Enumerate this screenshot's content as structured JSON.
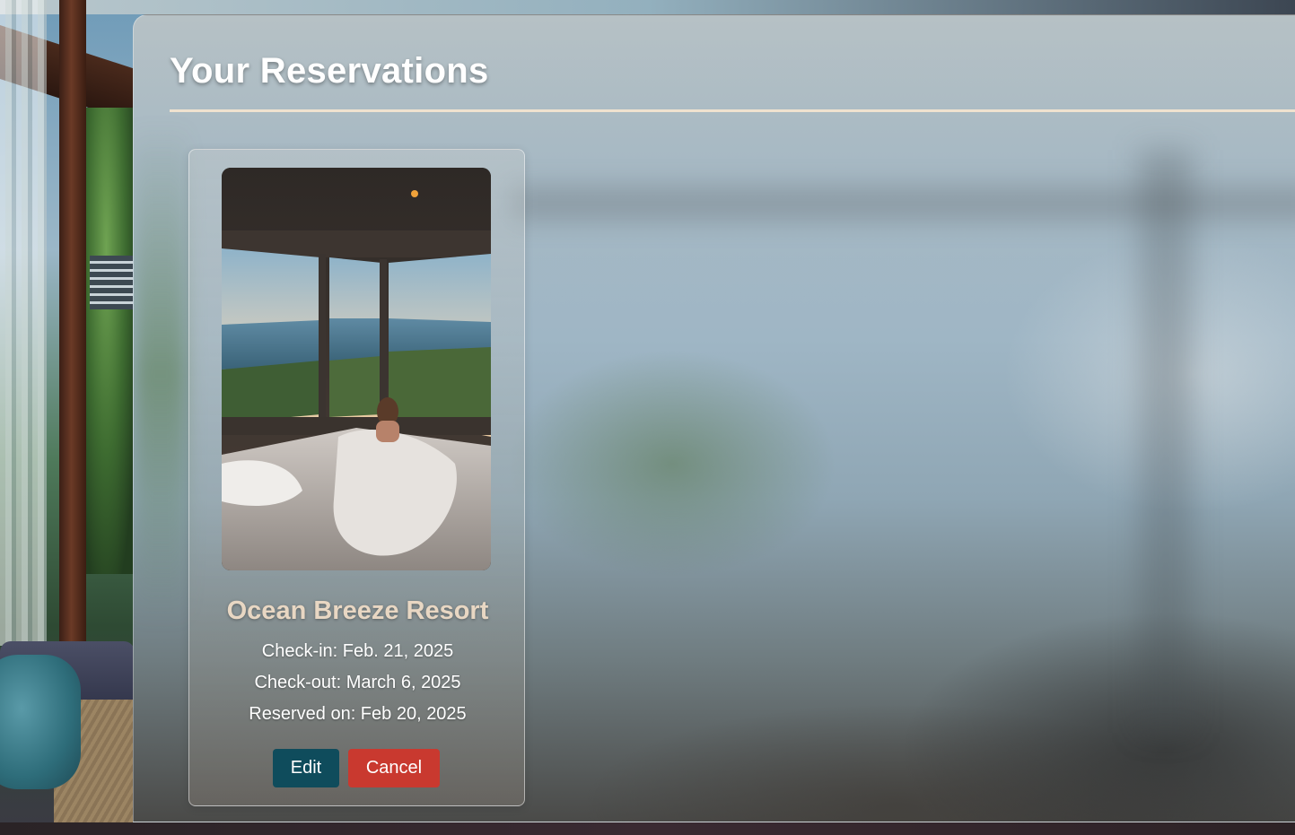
{
  "page": {
    "title": "Your Reservations"
  },
  "reservations": [
    {
      "hotel_name": "Ocean Breeze Resort",
      "checkin": "Check-in: Feb. 21, 2025",
      "checkout": "Check-out: March 6, 2025",
      "reserved_on": "Reserved on: Feb 20, 2025",
      "edit_label": "Edit",
      "cancel_label": "Cancel"
    }
  ],
  "colors": {
    "title_rule": "#efe2cf",
    "hotel_name": "#e8d7c3",
    "edit_button": "#0f4c5c",
    "cancel_button": "#c9392f"
  }
}
